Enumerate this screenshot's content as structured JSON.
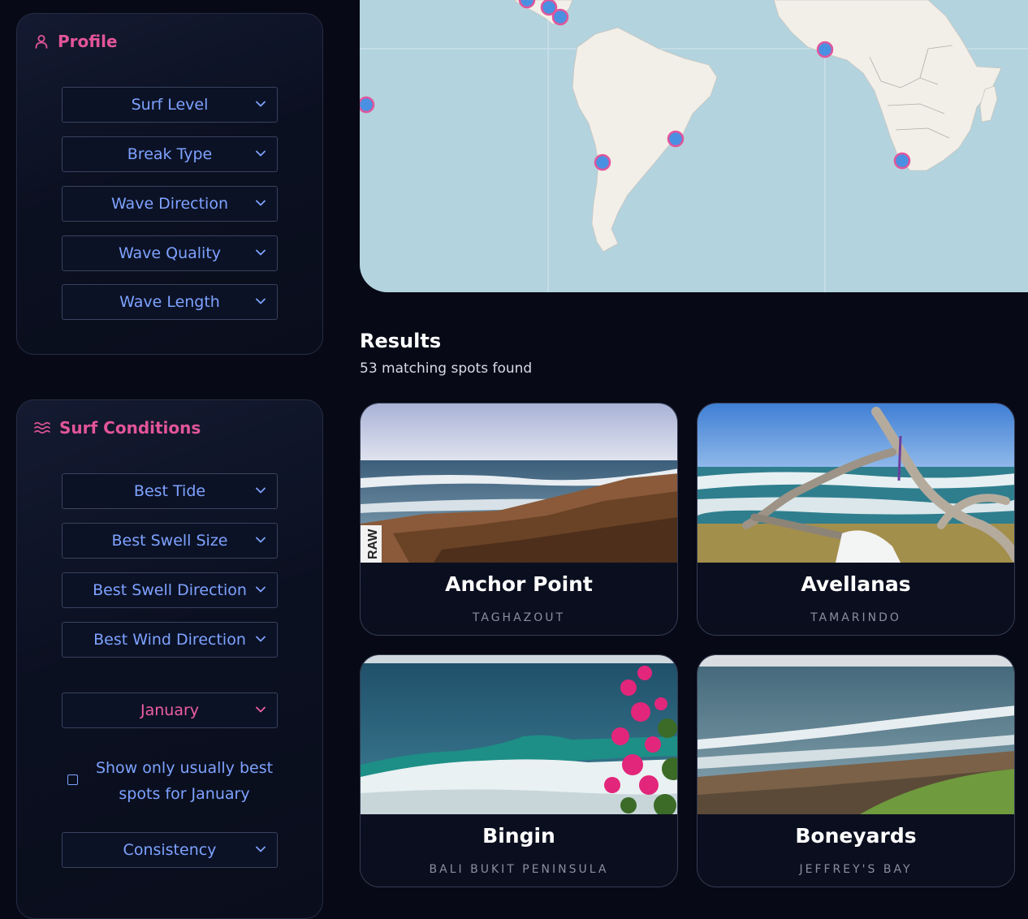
{
  "profile": {
    "title": "Profile",
    "filters": [
      "Surf Level",
      "Break Type",
      "Wave Direction",
      "Wave Quality",
      "Wave Length"
    ]
  },
  "conditions": {
    "title": "Surf Conditions",
    "filters": [
      "Best Tide",
      "Best Swell Size",
      "Best Swell Direction",
      "Best Wind Direction"
    ],
    "month": "January",
    "checkbox_label": "Show only usually best spots for January",
    "consistency": "Consistency"
  },
  "results": {
    "title": "Results",
    "count_text": "53 matching spots found",
    "cards": [
      {
        "name": "Anchor Point",
        "location": "TAGHAZOUT"
      },
      {
        "name": "Avellanas",
        "location": "TAMARINDO"
      },
      {
        "name": "Bingin",
        "location": "BALI BUKIT PENINSULA"
      },
      {
        "name": "Boneyards",
        "location": "JEFFREY'S BAY"
      }
    ]
  },
  "photo_overlay": {
    "text": "RAW"
  },
  "colors": {
    "accent_pink": "#e2559a",
    "select_text_blue": "#7ea2ff",
    "map_ocean": "#b3d3de",
    "map_land": "#f2efe9",
    "marker_fill": "#4a90e2",
    "marker_stroke": "#e2559a"
  },
  "icons": {
    "profile": "user-icon",
    "conditions": "waves-icon",
    "select": "chevron-down-icon"
  }
}
